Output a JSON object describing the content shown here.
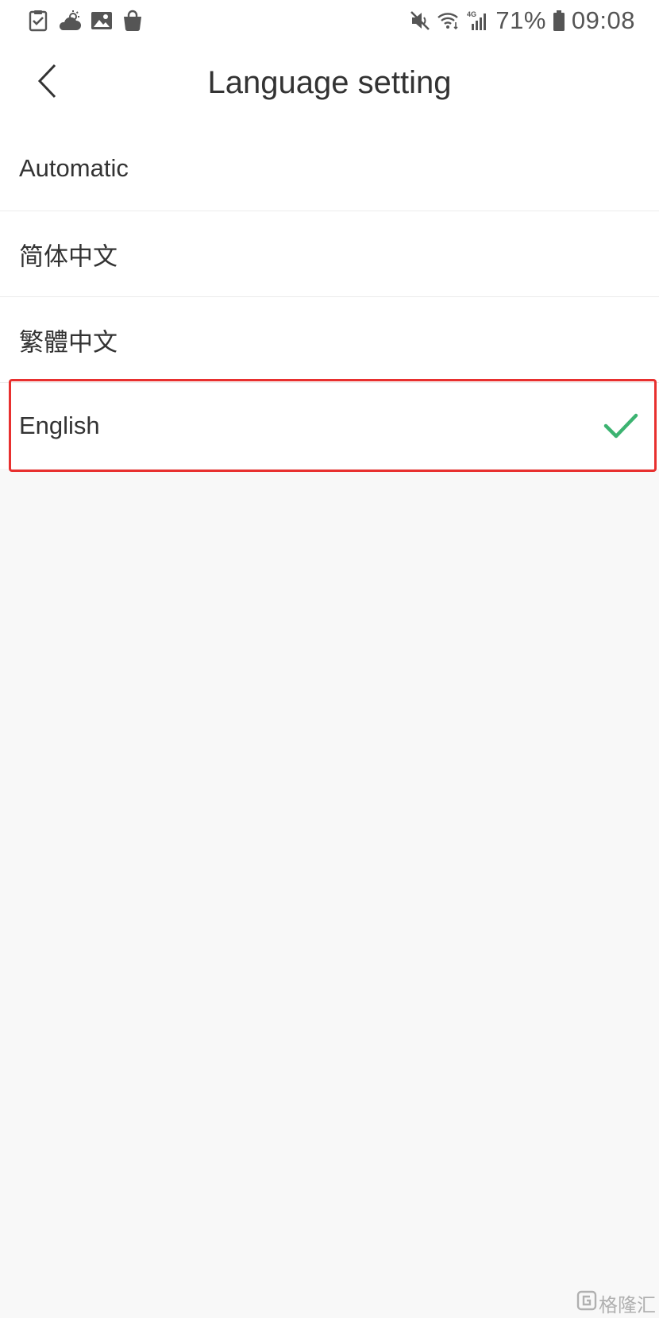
{
  "status_bar": {
    "left_icons": [
      "clipboard-check-icon",
      "weather-cloud-icon",
      "gallery-icon",
      "shopping-bag-icon"
    ],
    "right_icons": [
      "mute-icon",
      "wifi-icon",
      "signal-4g-icon",
      "battery-icon"
    ],
    "network_label": "4G",
    "battery_percent": "71%",
    "time": "09:08"
  },
  "header": {
    "title": "Language setting",
    "back_icon": "chevron-left-icon"
  },
  "languages": [
    {
      "label": "Automatic",
      "selected": false
    },
    {
      "label": "简体中文",
      "selected": false
    },
    {
      "label": "繁體中文",
      "selected": false
    },
    {
      "label": "English",
      "selected": true
    }
  ],
  "colors": {
    "check": "#3cb371",
    "highlight": "#e8302f",
    "background": "#f8f8f8",
    "surface": "#ffffff",
    "text": "#333333"
  },
  "watermark": {
    "text": "格隆汇",
    "icon": "watermark-logo-icon"
  }
}
